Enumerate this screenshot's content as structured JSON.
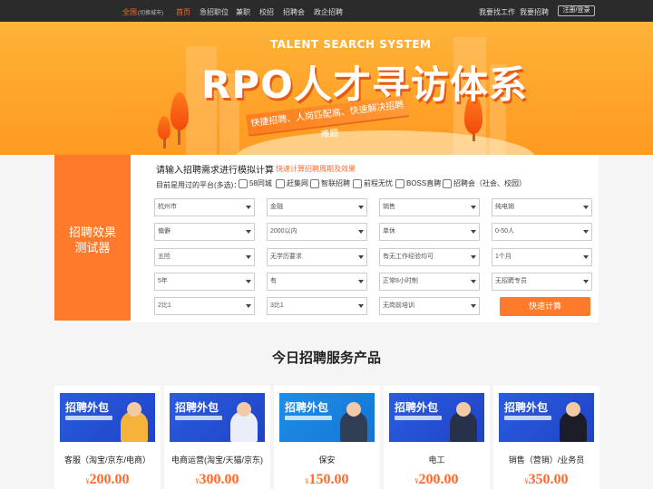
{
  "topnav": {
    "city": "全国",
    "switch_city": "(切换城市)",
    "items": [
      "首页",
      "急招职位",
      "兼职",
      "校招",
      "招聘会",
      "政企招聘"
    ],
    "find_job": "我要找工作",
    "recruit": "我要招聘",
    "login": "注册/登录",
    "accent": "#ff6a2b"
  },
  "banner": {
    "subtitle_en": "TALENT SEARCH SYSTEM",
    "title": "RPO人才寻访体系",
    "tagline": "快捷招聘、人岗匹配高、快速解决招聘难题"
  },
  "calculator": {
    "side_line1": "招聘效果",
    "side_line2": "测试器",
    "title": "请输入招聘需求进行模拟计算",
    "subtitle": "快速计算招聘周期及效果",
    "platform_label": "目前是用过的平台(多选)：",
    "platforms": [
      "58同城",
      "赶集网",
      "智联招聘",
      "前程无忧",
      "BOSS直聘",
      "招聘会（社会、校园）"
    ],
    "selects": [
      [
        "杭州市",
        "金融",
        "销售",
        "纯电销"
      ],
      [
        "偏僻",
        "2000以内",
        "单休",
        "0-50人"
      ],
      [
        "五险",
        "无学历要求",
        "有无工作经验均可",
        "1个月"
      ],
      [
        "5年",
        "有",
        "正常8小时制",
        "无招聘专员"
      ],
      [
        "2比1",
        "3比1",
        "无岗前培训"
      ]
    ],
    "button": "快速计算"
  },
  "products": {
    "section_title": "今日招聘服务产品",
    "banner_text": "招聘外包",
    "currency": "¥",
    "items": [
      {
        "name": "客服（淘宝/京东/电商）",
        "price": "200.00"
      },
      {
        "name": "电商运营(淘宝/天猫/京东)",
        "price": "300.00"
      },
      {
        "name": "保安",
        "price": "150.00"
      },
      {
        "name": "电工",
        "price": "200.00"
      },
      {
        "name": "销售（营销）/业务员",
        "price": "350.00"
      }
    ]
  }
}
